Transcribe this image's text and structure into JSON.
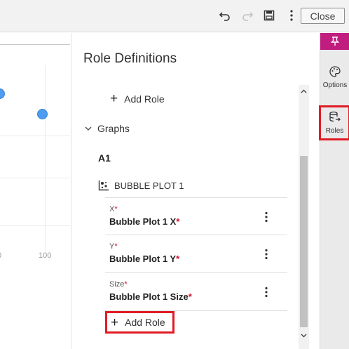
{
  "toolbar": {
    "undo_icon": "undo-icon",
    "redo_icon": "redo-icon",
    "save_icon": "save-icon",
    "more_icon": "more-vertical-icon",
    "close_label": "Close"
  },
  "canvas": {
    "x_tick_right": "100",
    "x_tick_left": "0"
  },
  "panel": {
    "title": "Role Definitions",
    "add_role_top": "Add Role",
    "graphs_label": "Graphs",
    "group_label": "A1",
    "plot_label": "BUBBLE PLOT 1",
    "roles": [
      {
        "label": "X",
        "value": "Bubble Plot 1 X"
      },
      {
        "label": "Y",
        "value": "Bubble Plot 1 Y"
      },
      {
        "label": "Size",
        "value": "Bubble Plot 1 Size"
      }
    ],
    "required_mark": "*",
    "add_role_bottom": "Add Role"
  },
  "rail": {
    "options_label": "Options",
    "roles_label": "Roles"
  },
  "colors": {
    "accent_pin": "#c11d7f",
    "highlight": "#e11b24",
    "bubble": "#4d9cf0"
  }
}
